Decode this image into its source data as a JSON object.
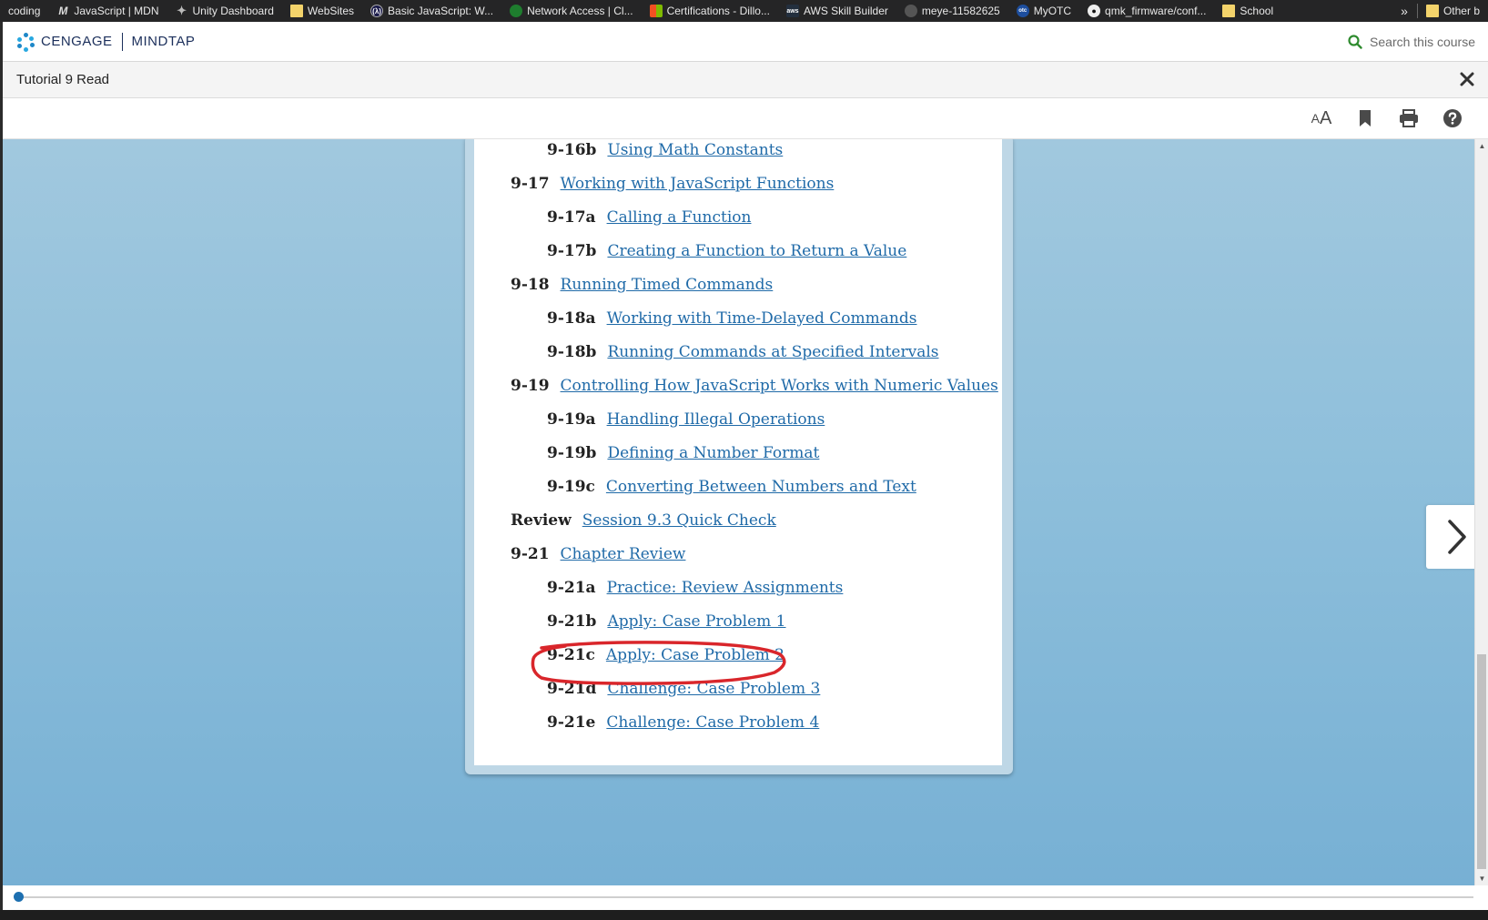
{
  "bookmarks_bar": {
    "items": [
      {
        "label": "coding",
        "icon": "none"
      },
      {
        "label": "JavaScript | MDN",
        "icon": "mdn-icon"
      },
      {
        "label": "Unity Dashboard",
        "icon": "unity-icon"
      },
      {
        "label": "WebSites",
        "icon": "folder-icon"
      },
      {
        "label": "Basic JavaScript: W...",
        "icon": "freecodecamp-icon"
      },
      {
        "label": "Network Access | Cl...",
        "icon": "network-icon"
      },
      {
        "label": "Certifications - Dillo...",
        "icon": "microsoft-icon"
      },
      {
        "label": "AWS Skill Builder",
        "icon": "aws-icon"
      },
      {
        "label": "meye-11582625",
        "icon": "user-icon"
      },
      {
        "label": "MyOTC",
        "icon": "otc-icon"
      },
      {
        "label": "qmk_firmware/conf...",
        "icon": "github-icon"
      },
      {
        "label": "School",
        "icon": "folder-icon"
      }
    ],
    "more": "»",
    "other": "Other b"
  },
  "header": {
    "brand": "CENGAGE",
    "product": "MINDTAP",
    "search_placeholder": "Search this course"
  },
  "title_bar": {
    "title": "Tutorial 9 Read"
  },
  "toolbar": {
    "text_size_small": "A",
    "text_size_big": "A"
  },
  "toc": {
    "entries": [
      {
        "num": "9-16b",
        "label": "Using Math Constants",
        "level": 2
      },
      {
        "num": "9-17",
        "label": "Working with JavaScript Functions",
        "level": 1
      },
      {
        "num": "9-17a",
        "label": "Calling a Function",
        "level": 2
      },
      {
        "num": "9-17b",
        "label": "Creating a Function to Return a Value",
        "level": 2
      },
      {
        "num": "9-18",
        "label": "Running Timed Commands",
        "level": 1
      },
      {
        "num": "9-18a",
        "label": "Working with Time-Delayed Commands",
        "level": 2
      },
      {
        "num": "9-18b",
        "label": "Running Commands at Specified Intervals",
        "level": 2
      },
      {
        "num": "9-19",
        "label": "Controlling How JavaScript Works with Numeric Values",
        "level": 1
      },
      {
        "num": "9-19a",
        "label": "Handling Illegal Operations",
        "level": 2
      },
      {
        "num": "9-19b",
        "label": "Defining a Number Format",
        "level": 2
      },
      {
        "num": "9-19c",
        "label": "Converting Between Numbers and Text",
        "level": 2
      },
      {
        "num": "Review",
        "label": "Session 9.3 Quick Check",
        "level": 1
      },
      {
        "num": "9-21",
        "label": "Chapter Review",
        "level": 1
      },
      {
        "num": "9-21a",
        "label": "Practice: Review Assignments",
        "level": 2
      },
      {
        "num": "9-21b",
        "label": "Apply: Case Problem 1",
        "level": 2
      },
      {
        "num": "9-21c",
        "label": "Apply: Case Problem 2",
        "level": 2
      },
      {
        "num": "9-21d",
        "label": "Challenge: Case Problem 3",
        "level": 2
      },
      {
        "num": "9-21e",
        "label": "Challenge: Case Problem 4",
        "level": 2
      }
    ],
    "highlighted_entry": "9-21c",
    "annotation_color": "#d9262b"
  },
  "progress": {
    "fraction": 0.0
  },
  "colors": {
    "link": "#1f6aa8",
    "brand": "#1b2f5b",
    "accent": "#1d6fb0",
    "search_icon": "#2e8b2e"
  }
}
